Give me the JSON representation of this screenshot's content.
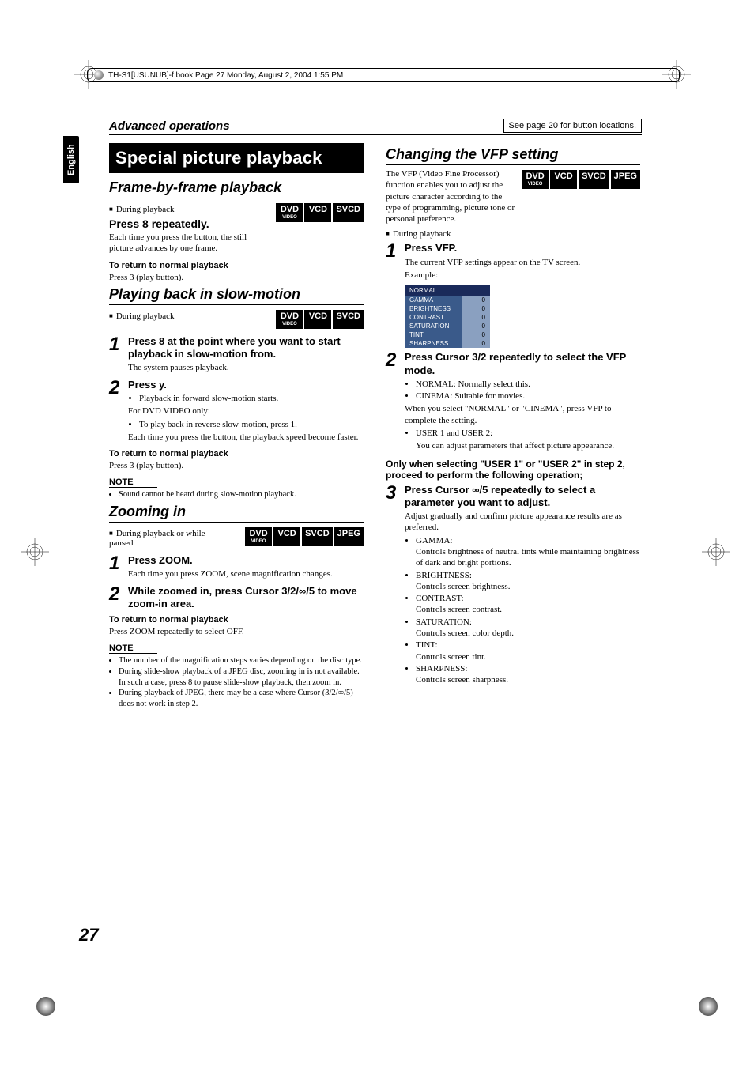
{
  "meta": {
    "frame_text": "TH-S1[USUNUB]-f.book  Page 27  Monday, August 2, 2004  1:55 PM",
    "language_tab": "English",
    "page_number": "27"
  },
  "header": {
    "section": "Advanced operations",
    "see_page": "See page 20 for button locations."
  },
  "badges": {
    "dvd": "DVD",
    "dvd_sub": "VIDEO",
    "vcd": "VCD",
    "svcd": "SVCD",
    "jpeg": "JPEG"
  },
  "left": {
    "banner": "Special picture playback",
    "frame": {
      "heading": "Frame-by-frame playback",
      "timing": "During playback",
      "instr": "Press 8 repeatedly.",
      "body": "Each time you press the button, the still picture advances by one frame.",
      "return_label": "To return to normal playback",
      "return_body": "Press 3 (play button)."
    },
    "slow": {
      "heading": "Playing back in slow-motion",
      "timing": "During playback",
      "step1": "Press 8 at the point where you want to start playback in slow-motion from.",
      "step1_body": "The system pauses playback.",
      "step2": "Press y.",
      "step2_b1": "Playback in forward slow-motion starts.",
      "step2_body1": "For DVD VIDEO only:",
      "step2_b2": "To play back in reverse slow-motion, press 1.",
      "step2_body2": "Each time you press the button, the playback speed become faster.",
      "return_label": "To return to normal playback",
      "return_body": "Press 3 (play button).",
      "note_label": "NOTE",
      "note1": "Sound cannot be heard during slow-motion playback."
    },
    "zoom": {
      "heading": "Zooming in",
      "timing": "During playback or while paused",
      "step1": "Press ZOOM.",
      "step1_body": "Each time you press ZOOM, scene magnification changes.",
      "step2": "While zoomed in, press Cursor 3/2/∞/5 to move zoom-in area.",
      "return_label": "To return to normal playback",
      "return_body": "Press ZOOM repeatedly to select OFF.",
      "note_label": "NOTE",
      "note1": "The number of the magnification steps varies depending on the disc type.",
      "note2": "During slide-show playback of a JPEG disc, zooming in is not available. In such a case, press 8 to pause slide-show playback, then zoom in.",
      "note3": "During playback of JPEG, there may be a case where Cursor (3/2/∞/5) does not work in step 2."
    }
  },
  "right": {
    "vfp": {
      "heading": "Changing the VFP setting",
      "intro": "The VFP (Video Fine Processor) function enables you to adjust the picture character according to the type of programming, picture tone or personal preference.",
      "timing": "During playback",
      "step1": "Press VFP.",
      "step1_body": "The current VFP settings appear on the TV screen.",
      "example_label": "Example:",
      "table_header": "NORMAL",
      "params": [
        {
          "name": "GAMMA",
          "val": "0"
        },
        {
          "name": "BRIGHTNESS",
          "val": "0"
        },
        {
          "name": "CONTRAST",
          "val": "0"
        },
        {
          "name": "SATURATION",
          "val": "0"
        },
        {
          "name": "TINT",
          "val": "0"
        },
        {
          "name": "SHARPNESS",
          "val": "0"
        }
      ],
      "step2": "Press Cursor 3/2 repeatedly to select the VFP mode.",
      "step2_b1": "NORMAL: Normally select this.",
      "step2_b2": "CINEMA:   Suitable for movies.",
      "step2_body1": "When you select \"NORMAL\" or \"CINEMA\", press VFP to complete the setting.",
      "step2_b3": "USER 1 and USER 2:",
      "step2_body2": "You can adjust parameters that affect picture appearance.",
      "only_when": "Only when selecting \"USER 1\" or \"USER 2\" in step 2, proceed to perform the following operation;",
      "step3": "Press Cursor ∞/5 repeatedly to select a parameter you want to adjust.",
      "step3_body": "Adjust gradually and confirm picture appearance results are as preferred.",
      "p_gamma": "GAMMA:",
      "p_gamma_d": "Controls brightness of neutral tints while maintaining brightness of dark and bright portions.",
      "p_bright": "BRIGHTNESS:",
      "p_bright_d": "Controls screen brightness.",
      "p_contrast": "CONTRAST:",
      "p_contrast_d": "Controls screen contrast.",
      "p_sat": "SATURATION:",
      "p_sat_d": "Controls screen color depth.",
      "p_tint": "TINT:",
      "p_tint_d": "Controls screen tint.",
      "p_sharp": "SHARPNESS:",
      "p_sharp_d": "Controls screen sharpness."
    }
  }
}
